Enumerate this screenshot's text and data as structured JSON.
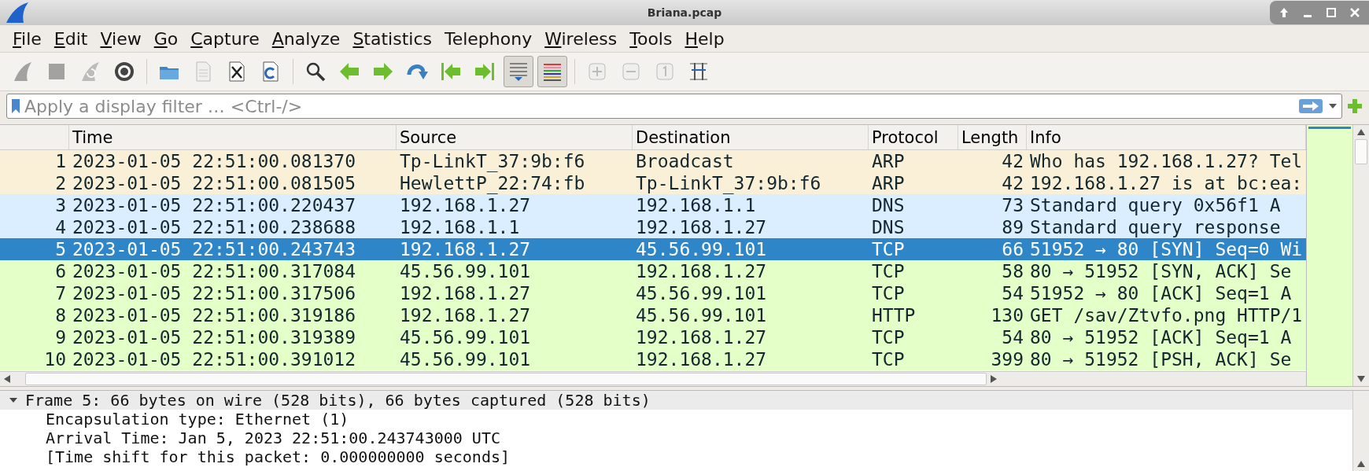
{
  "window": {
    "title": "Briana.pcap"
  },
  "menu": [
    {
      "label": "File",
      "underline_first": true
    },
    {
      "label": "Edit",
      "underline_first": true
    },
    {
      "label": "View",
      "underline_first": true
    },
    {
      "label": "Go",
      "underline_first": true
    },
    {
      "label": "Capture",
      "underline_first": true
    },
    {
      "label": "Analyze",
      "underline_first": true
    },
    {
      "label": "Statistics",
      "underline_first": true
    },
    {
      "label": "Telephony",
      "underline_first": false
    },
    {
      "label": "Wireless",
      "underline_first": true
    },
    {
      "label": "Tools",
      "underline_first": true
    },
    {
      "label": "Help",
      "underline_first": true
    }
  ],
  "toolbar": [
    {
      "kind": "fin",
      "disabled": true
    },
    {
      "kind": "stop",
      "disabled": true
    },
    {
      "kind": "restart",
      "disabled": true
    },
    {
      "kind": "gear",
      "disabled": false
    },
    {
      "kind": "sep"
    },
    {
      "kind": "folder",
      "disabled": false
    },
    {
      "kind": "file",
      "disabled": true
    },
    {
      "kind": "closefile",
      "disabled": false
    },
    {
      "kind": "reload",
      "disabled": false
    },
    {
      "kind": "sep"
    },
    {
      "kind": "search",
      "disabled": false
    },
    {
      "kind": "back",
      "disabled": false
    },
    {
      "kind": "forward",
      "disabled": false
    },
    {
      "kind": "jump",
      "disabled": false
    },
    {
      "kind": "first",
      "disabled": false
    },
    {
      "kind": "last",
      "disabled": false
    },
    {
      "kind": "autoscroll",
      "disabled": false,
      "on": true
    },
    {
      "kind": "colorize",
      "disabled": false,
      "on": true
    },
    {
      "kind": "sep"
    },
    {
      "kind": "zoomin",
      "disabled": true
    },
    {
      "kind": "zoomout",
      "disabled": true
    },
    {
      "kind": "normal",
      "disabled": true
    },
    {
      "kind": "resize",
      "disabled": false
    }
  ],
  "filter": {
    "placeholder": "Apply a display filter … <Ctrl-/>"
  },
  "table": {
    "columns": [
      "Time",
      "Source",
      "Destination",
      "Protocol",
      "Length",
      "Info"
    ],
    "rows": [
      {
        "no": "1",
        "time": "2023-01-05 22:51:00.081370",
        "source": "Tp-LinkT_37:9b:f6",
        "destination": "Broadcast",
        "protocol": "ARP",
        "length": "42",
        "info": "Who has 192.168.1.27? Tel",
        "color": "#faf0d7",
        "selected": false
      },
      {
        "no": "2",
        "time": "2023-01-05 22:51:00.081505",
        "source": "HewlettP_22:74:fb",
        "destination": "Tp-LinkT_37:9b:f6",
        "protocol": "ARP",
        "length": "42",
        "info": "192.168.1.27 is at bc:ea:",
        "color": "#faf0d7",
        "selected": false
      },
      {
        "no": "3",
        "time": "2023-01-05 22:51:00.220437",
        "source": "192.168.1.27",
        "destination": "192.168.1.1",
        "protocol": "DNS",
        "length": "73",
        "info": "Standard query 0x56f1 A",
        "color": "#daeeff",
        "selected": false
      },
      {
        "no": "4",
        "time": "2023-01-05 22:51:00.238688",
        "source": "192.168.1.1",
        "destination": "192.168.1.27",
        "protocol": "DNS",
        "length": "89",
        "info": "Standard query response",
        "color": "#daeeff",
        "selected": false
      },
      {
        "no": "5",
        "time": "2023-01-05 22:51:00.243743",
        "source": "192.168.1.27",
        "destination": "45.56.99.101",
        "protocol": "TCP",
        "length": "66",
        "info": "51952 → 80 [SYN] Seq=0 Wi",
        "selected": true
      },
      {
        "no": "6",
        "time": "2023-01-05 22:51:00.317084",
        "source": "45.56.99.101",
        "destination": "192.168.1.27",
        "protocol": "TCP",
        "length": "58",
        "info": "80 → 51952 [SYN, ACK] Se",
        "color": "#e4ffc7",
        "selected": false
      },
      {
        "no": "7",
        "time": "2023-01-05 22:51:00.317506",
        "source": "192.168.1.27",
        "destination": "45.56.99.101",
        "protocol": "TCP",
        "length": "54",
        "info": "51952 → 80 [ACK] Seq=1 A",
        "color": "#e4ffc7",
        "selected": false
      },
      {
        "no": "8",
        "time": "2023-01-05 22:51:00.319186",
        "source": "192.168.1.27",
        "destination": "45.56.99.101",
        "protocol": "HTTP",
        "length": "130",
        "info": "GET /sav/Ztvfo.png HTTP/1",
        "color": "#e4ffc7",
        "selected": false
      },
      {
        "no": "9",
        "time": "2023-01-05 22:51:00.319389",
        "source": "45.56.99.101",
        "destination": "192.168.1.27",
        "protocol": "TCP",
        "length": "54",
        "info": "80 → 51952 [ACK] Seq=1 A",
        "color": "#e4ffc7",
        "selected": false
      },
      {
        "no": "10",
        "time": "2023-01-05 22:51:00.391012",
        "source": "45.56.99.101",
        "destination": "192.168.1.27",
        "protocol": "TCP",
        "length": "399",
        "info": "80 → 51952 [PSH, ACK] Se",
        "color": "#e4ffc7",
        "selected": false
      }
    ]
  },
  "details": [
    {
      "text": "Frame 5: 66 bytes on wire (528 bits), 66 bytes captured (528 bits)",
      "expanded": true,
      "selected": true,
      "children": [
        {
          "text": "Encapsulation type: Ethernet (1)"
        },
        {
          "text": "Arrival Time: Jan  5, 2023 22:51:00.243743000 UTC"
        },
        {
          "text": "[Time shift for this packet: 0.000000000 seconds]"
        }
      ]
    }
  ]
}
